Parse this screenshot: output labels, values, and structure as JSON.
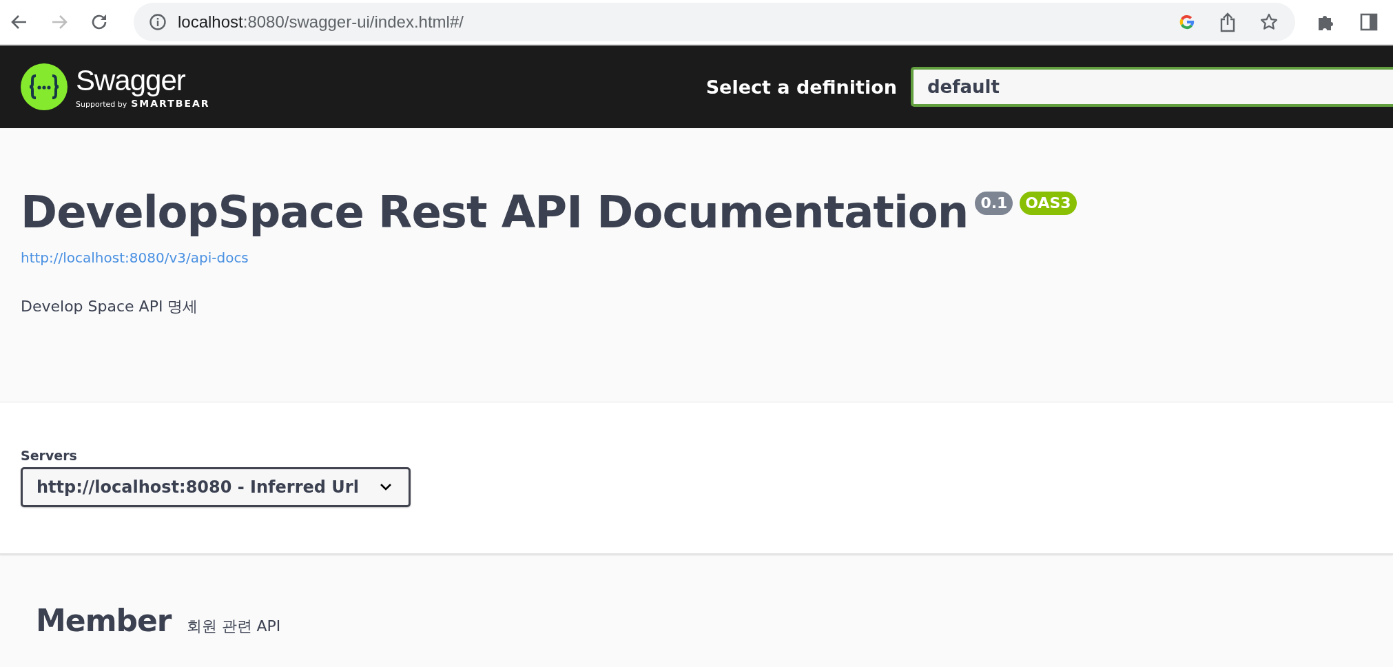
{
  "browser": {
    "url_host": "localhost",
    "url_path": ":8080/swagger-ui/index.html#/"
  },
  "header": {
    "logo_text": "Swagger",
    "tagline_prefix": "Supported by",
    "tagline_brand": "SMARTBEAR",
    "definition_label": "Select a definition",
    "definition_value": "default"
  },
  "info": {
    "title": "DevelopSpace Rest API Documentation",
    "version": "0.1",
    "spec": "OAS3",
    "spec_url": "http://localhost:8080/v3/api-docs",
    "description": "Develop Space API 명세"
  },
  "servers": {
    "label": "Servers",
    "selected": "http://localhost:8080 - Inferred Url"
  },
  "tags": [
    {
      "name": "Member",
      "description": "회원 관련 API"
    }
  ]
}
